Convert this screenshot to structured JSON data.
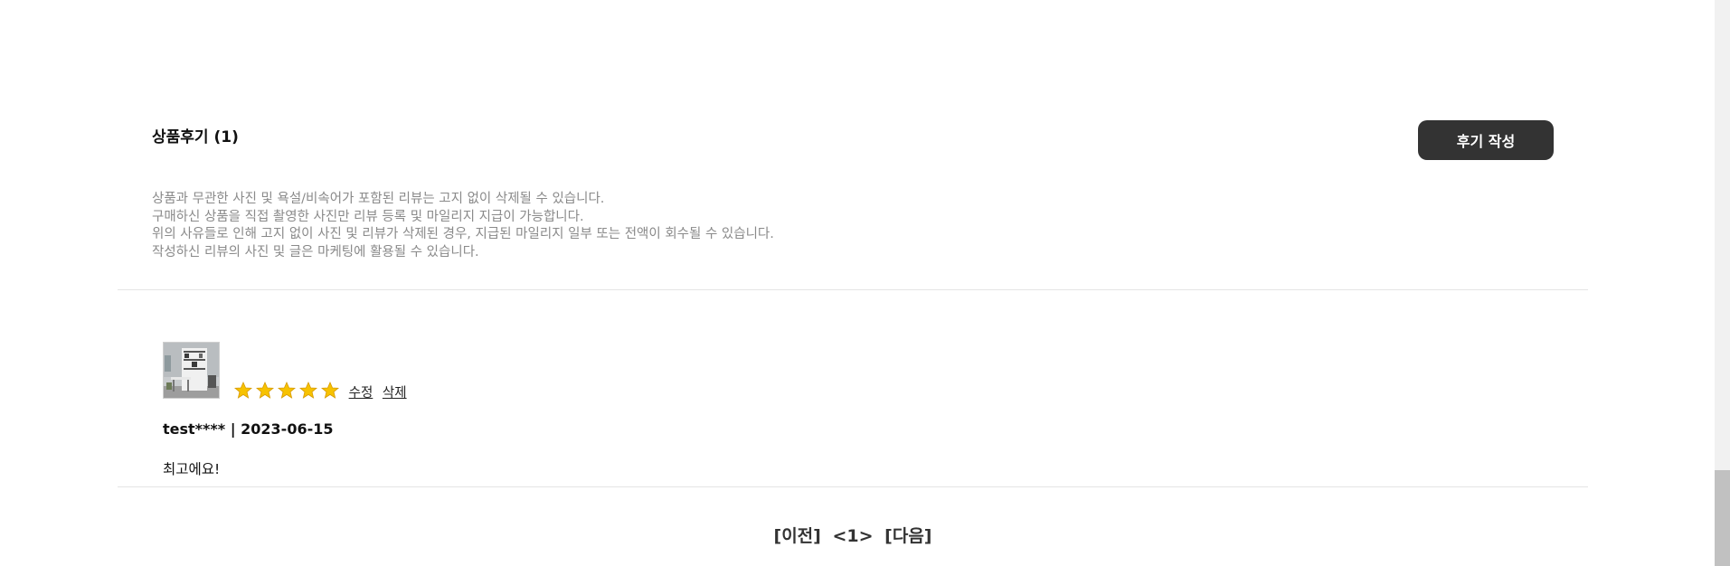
{
  "reviews_section": {
    "title": "상품후기",
    "count": "(1)",
    "write_button_label": "후기 작성",
    "notices": [
      "상품과 무관한 사진 및 욕설/비속어가 포함된 리뷰는 고지 없이 삭제될 수 있습니다.",
      "구매하신 상품을 직접 촬영한 사진만 리뷰 등록 및 마일리지 지급이 가능합니다.",
      "위의 사유들로 인해 고지 없이 사진 및 리뷰가 삭제된 경우, 지급된 마일리지 일부 또는 전액이 회수될 수 있습니다.",
      "작성하신 리뷰의 사진 및 글은 마케팅에 활용될 수 있습니다."
    ]
  },
  "review": {
    "rating": 5,
    "rating_max": 5,
    "edit_label": "수정",
    "delete_label": "삭제",
    "author": "test****",
    "separator": "|",
    "date": "2023-06-15",
    "content": "최고에요!",
    "thumbnail_icon": "furniture-photo"
  },
  "pagination": {
    "prev_label": "[이전]",
    "current_page": "<1>",
    "next_label": "[다음]"
  },
  "colors": {
    "button_bg": "#333333",
    "notice_text": "#8a8a8a",
    "star": "#f5b400"
  }
}
